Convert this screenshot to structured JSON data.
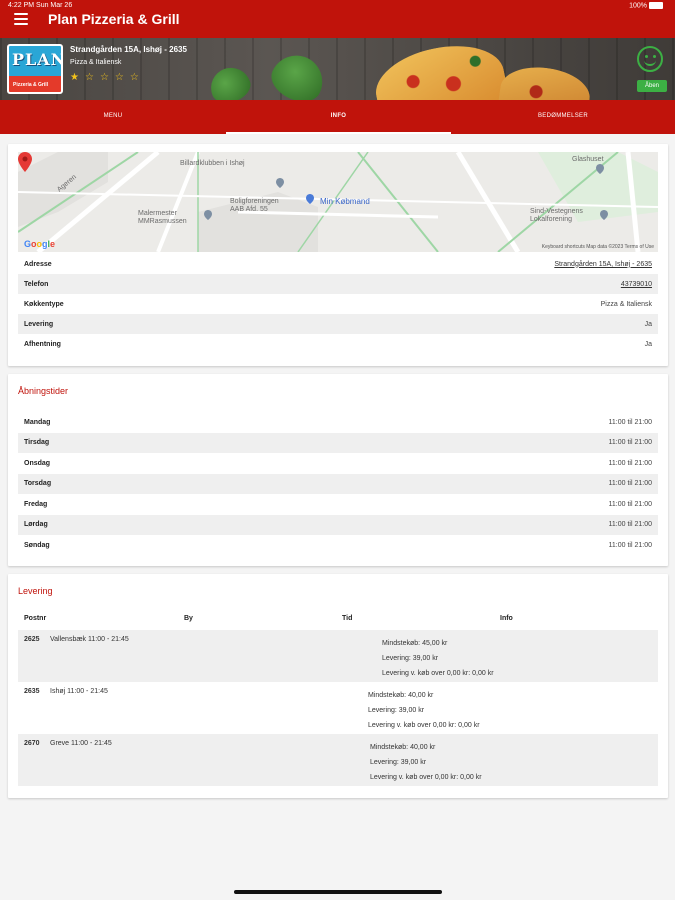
{
  "status_bar": {
    "time": "4:22 PM",
    "date": "Sun Mar 26",
    "battery": "100%"
  },
  "app_bar": {
    "title": "Plan Pizzeria & Grill"
  },
  "restaurant": {
    "name_address": "Strandgården 15A, Ishøj - 2635",
    "cuisine": "Pizza & Italiensk",
    "rating": 1,
    "rating_max": 5,
    "open_label": "Åben",
    "logo_text": "PLAN",
    "logo_sub": "Pizzeria & Grill"
  },
  "tabs": [
    {
      "label": "MENU",
      "active": false
    },
    {
      "label": "INFO",
      "active": true
    },
    {
      "label": "BEDØMMELSER",
      "active": false
    }
  ],
  "map": {
    "labels": {
      "billard": "Billardklubben i Ishøj",
      "bolig": "Boligforeningen",
      "bolig2": "AAB Afd. 55",
      "malermester": "Malermester",
      "malermester2": "MMRasmussen",
      "kobmand": "Min Købmand",
      "glashuset": "Glashuset",
      "sind": "Sind-Vestegnens",
      "sind2": "Lokalforening",
      "road": "Ageren"
    },
    "attribution": "Keyboard shortcuts   Map data ©2023   Terms of Use",
    "google": [
      "G",
      "o",
      "o",
      "g",
      "l",
      "e"
    ]
  },
  "info": [
    {
      "label": "Adresse",
      "value": "Strandgården 15A, Ishøj - 2635",
      "link": true
    },
    {
      "label": "Telefon",
      "value": "43739010",
      "link": true
    },
    {
      "label": "Køkkentype",
      "value": "Pizza & Italiensk",
      "link": false
    },
    {
      "label": "Levering",
      "value": "Ja",
      "link": false
    },
    {
      "label": "Afhentning",
      "value": "Ja",
      "link": false
    }
  ],
  "hours": {
    "title": "Åbningstider",
    "days": [
      {
        "day": "Mandag",
        "time": "11:00 til 21:00"
      },
      {
        "day": "Tirsdag",
        "time": "11:00 til 21:00"
      },
      {
        "day": "Onsdag",
        "time": "11:00 til 21:00"
      },
      {
        "day": "Torsdag",
        "time": "11:00 til 21:00"
      },
      {
        "day": "Fredag",
        "time": "11:00 til 21:00"
      },
      {
        "day": "Lørdag",
        "time": "11:00 til 21:00"
      },
      {
        "day": "Søndag",
        "time": "11:00 til 21:00"
      }
    ]
  },
  "delivery": {
    "title": "Levering",
    "headers": {
      "postnr": "Postnr",
      "by": "By",
      "tid": "Tid",
      "info": "Info"
    },
    "zones": [
      {
        "zip": "2625",
        "city": "Vallensbæk   11:00 - 21:45",
        "min": "Mindstekøb: 45,00 kr",
        "fee": "Levering: 39,00 kr",
        "free": "Levering v. køb over 0,00 kr: 0,00 kr"
      },
      {
        "zip": "2635",
        "city": "Ishøj   11:00 - 21:45",
        "min": "Mindstekøb: 40,00 kr",
        "fee": "Levering: 39,00 kr",
        "free": "Levering v. køb over 0,00 kr: 0,00 kr"
      },
      {
        "zip": "2670",
        "city": "Greve   11:00 - 21:45",
        "min": "Mindstekøb: 40,00 kr",
        "fee": "Levering: 39,00 kr",
        "free": "Levering v. køb over 0,00 kr: 0,00 kr"
      }
    ]
  },
  "colors": {
    "brand": "#c0130b",
    "open": "#3cb044",
    "star": "#f2c21b"
  }
}
